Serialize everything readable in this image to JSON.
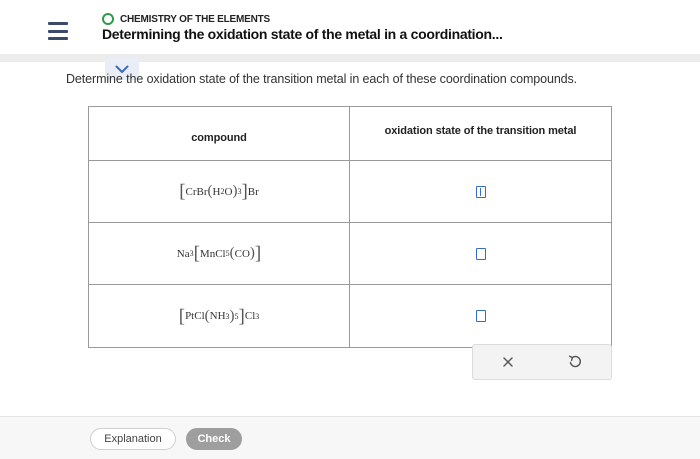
{
  "header": {
    "topic": "CHEMISTRY OF THE ELEMENTS",
    "title": "Determining the oxidation state of the metal in a coordination...",
    "menu_icon": "hamburger-icon",
    "topic_icon": "progress-ring-icon",
    "expand_icon": "chevron-down-icon"
  },
  "instruction": "Determine the oxidation state of the transition metal in each of these coordination compounds.",
  "table": {
    "headers": [
      "compound",
      "oxidation state of the transition metal"
    ],
    "rows": [
      {
        "compound": {
          "pre": "",
          "metal": "CrBr",
          "ligand": "H",
          "ligand_sub": "2",
          "ligand_tail": "O",
          "paren_sub": "3",
          "post": "Br",
          "post_sub": ""
        },
        "answer": ""
      },
      {
        "compound": {
          "pre": "Na",
          "pre_sub": "3",
          "metal": "MnCl",
          "metal_sub": "5",
          "ligand": "CO",
          "post": ""
        },
        "answer": ""
      },
      {
        "compound": {
          "pre": "",
          "metal": "PtCl",
          "ligand": "NH",
          "ligand_sub": "3",
          "paren_sub": "5",
          "post": "Cl",
          "post_sub": "3"
        },
        "answer": ""
      }
    ]
  },
  "actions": {
    "clear_icon": "close-icon",
    "undo_icon": "undo-icon"
  },
  "footer": {
    "explanation_label": "Explanation",
    "check_label": "Check"
  },
  "colors": {
    "accent": "#3a6bc0",
    "topic_ring": "#2e9a4a",
    "check_button": "#9e9e9e"
  }
}
